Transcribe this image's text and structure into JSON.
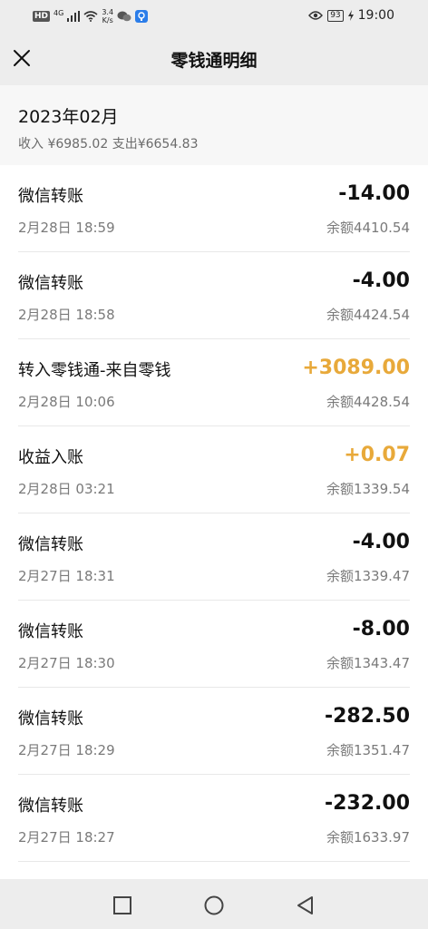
{
  "status": {
    "hd": "HD",
    "network": "4G",
    "speed_value": "3.4",
    "speed_unit": "K/s",
    "battery": "93",
    "time": "19:00"
  },
  "nav": {
    "title": "零钱通明细"
  },
  "month": {
    "label": "2023年02月",
    "summary": "收入 ¥6985.02 支出¥6654.83"
  },
  "transactions": [
    {
      "title": "微信转账",
      "amount": "-14.00",
      "time": "2月28日 18:59",
      "balance": "余额4410.54",
      "type": "expense"
    },
    {
      "title": "微信转账",
      "amount": "-4.00",
      "time": "2月28日 18:58",
      "balance": "余额4424.54",
      "type": "expense"
    },
    {
      "title": "转入零钱通-来自零钱",
      "amount": "+3089.00",
      "time": "2月28日 10:06",
      "balance": "余额4428.54",
      "type": "income"
    },
    {
      "title": "收益入账",
      "amount": "+0.07",
      "time": "2月28日 03:21",
      "balance": "余额1339.54",
      "type": "income"
    },
    {
      "title": "微信转账",
      "amount": "-4.00",
      "time": "2月27日 18:31",
      "balance": "余额1339.47",
      "type": "expense"
    },
    {
      "title": "微信转账",
      "amount": "-8.00",
      "time": "2月27日 18:30",
      "balance": "余额1343.47",
      "type": "expense"
    },
    {
      "title": "微信转账",
      "amount": "-282.50",
      "time": "2月27日 18:29",
      "balance": "余额1351.47",
      "type": "expense"
    },
    {
      "title": "微信转账",
      "amount": "-232.00",
      "time": "2月27日 18:27",
      "balance": "余额1633.97",
      "type": "expense"
    }
  ],
  "colors": {
    "income": "#e8a93a",
    "expense": "#111111",
    "background": "#ededed"
  },
  "icons": {
    "close": "close-icon",
    "wifi": "wifi-icon",
    "signal": "signal-icon",
    "wechat": "wechat-icon",
    "eye": "eye-icon",
    "charging": "charging-icon",
    "nav_recent": "square-icon",
    "nav_home": "circle-icon",
    "nav_back": "triangle-back-icon"
  }
}
